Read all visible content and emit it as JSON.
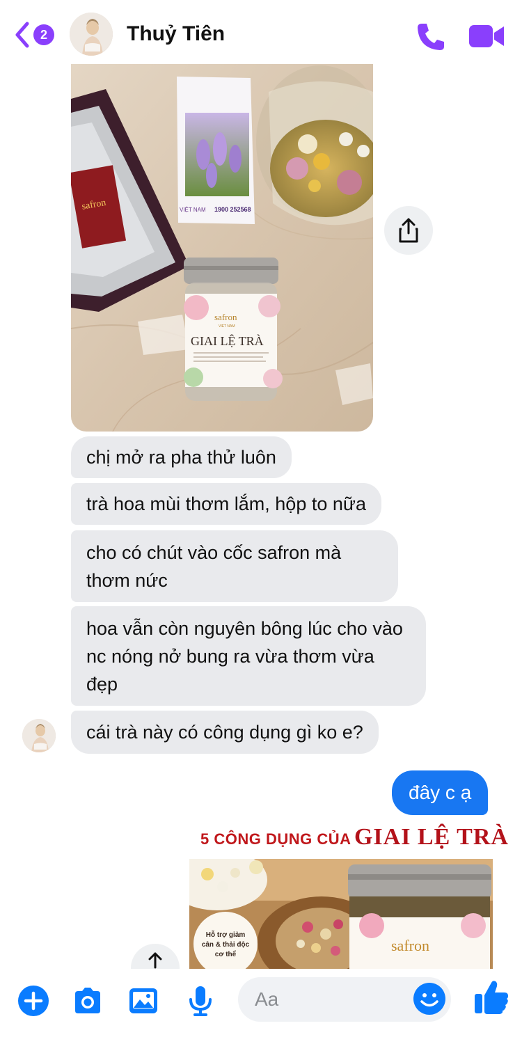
{
  "header": {
    "back_badge": "2",
    "contact_name": "Thuỷ Tiên"
  },
  "messages": {
    "received": [
      "chị mở ra pha thử luôn",
      "trà hoa mùi thơm lắm, hộp to nữa",
      "cho có chút vào cốc safron mà thơm nức",
      "hoa vẫn còn nguyên bông lúc cho vào nc nóng nở bung ra vừa thơm vừa đẹp",
      "cái trà này có công dụng gì ko e?"
    ],
    "sent": "đây c ạ"
  },
  "photo_in": {
    "brochure_phone": "1900 252568",
    "brochure_side": "VIỆT NAM",
    "box_brand": "safron",
    "jar_brand": "safron",
    "jar_sub": "VIET NAM",
    "jar_title": "GIAI LỆ TRÀ"
  },
  "photo_out": {
    "title_small": "5 CÔNG DỤNG CỦA",
    "title_big": "GIAI LỆ TRÀ",
    "caption_line1": "Hỗ trợ giảm",
    "caption_line2": "cân & thải độc",
    "caption_line3": "cơ thể",
    "jar_brand": "safron"
  },
  "composer": {
    "placeholder": "Aa"
  },
  "colors": {
    "accent_purple": "#8a3ffc",
    "messenger_blue": "#1877f2",
    "bubble_gray": "#e9eaed",
    "title_red": "#b3121a"
  }
}
